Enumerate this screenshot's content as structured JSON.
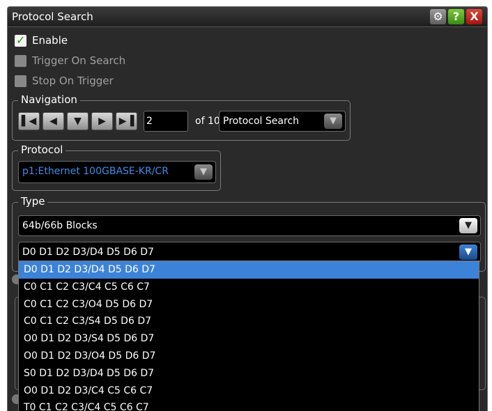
{
  "title": "Protocol Search",
  "title_buttons": {
    "help": "?",
    "close": "X"
  },
  "checkboxes": [
    {
      "label": "Enable",
      "checked": true,
      "enabled": true
    },
    {
      "label": "Trigger On Search",
      "checked": false,
      "enabled": false
    },
    {
      "label": "Stop On Trigger",
      "checked": false,
      "enabled": false
    }
  ],
  "navigation": {
    "legend": "Navigation",
    "buttons": [
      "first-icon",
      "previous-icon",
      "down-icon",
      "next-icon",
      "last-icon"
    ],
    "current": "2",
    "of_text": "of 10",
    "mode": "Protocol Search"
  },
  "protocol": {
    "legend": "Protocol",
    "selected": "p1:Ethernet 100GBASE-KR/CR",
    "selected_color": "#3c8ee8"
  },
  "type": {
    "legend": "Type",
    "primary": "64b/66b Blocks",
    "secondary": "D0 D1 D2 D3/D4 D5 D6 D7"
  },
  "dropdown": {
    "selected_index": 0,
    "highlight_color": "#3c82d8",
    "options": [
      "D0 D1 D2 D3/D4 D5 D6 D7",
      "C0 C1 C2 C3/C4 C5 C6 C7",
      "C0 C1 C2 C3/O4 D5 D6 D7",
      "C0 C1 C2 C3/S4 D5 D6 D7",
      "O0 D1 D2 D3/S4 D5 D6 D7",
      "O0 D1 D2 D3/O4 D5 D6 D7",
      "S0 D1 D2 D3/D4 D5 D6 D7",
      "O0 D1 D2 D3/C4 C5 C6 C7",
      "T0 C1 C2 C3/C4 C5 C6 C7"
    ]
  }
}
